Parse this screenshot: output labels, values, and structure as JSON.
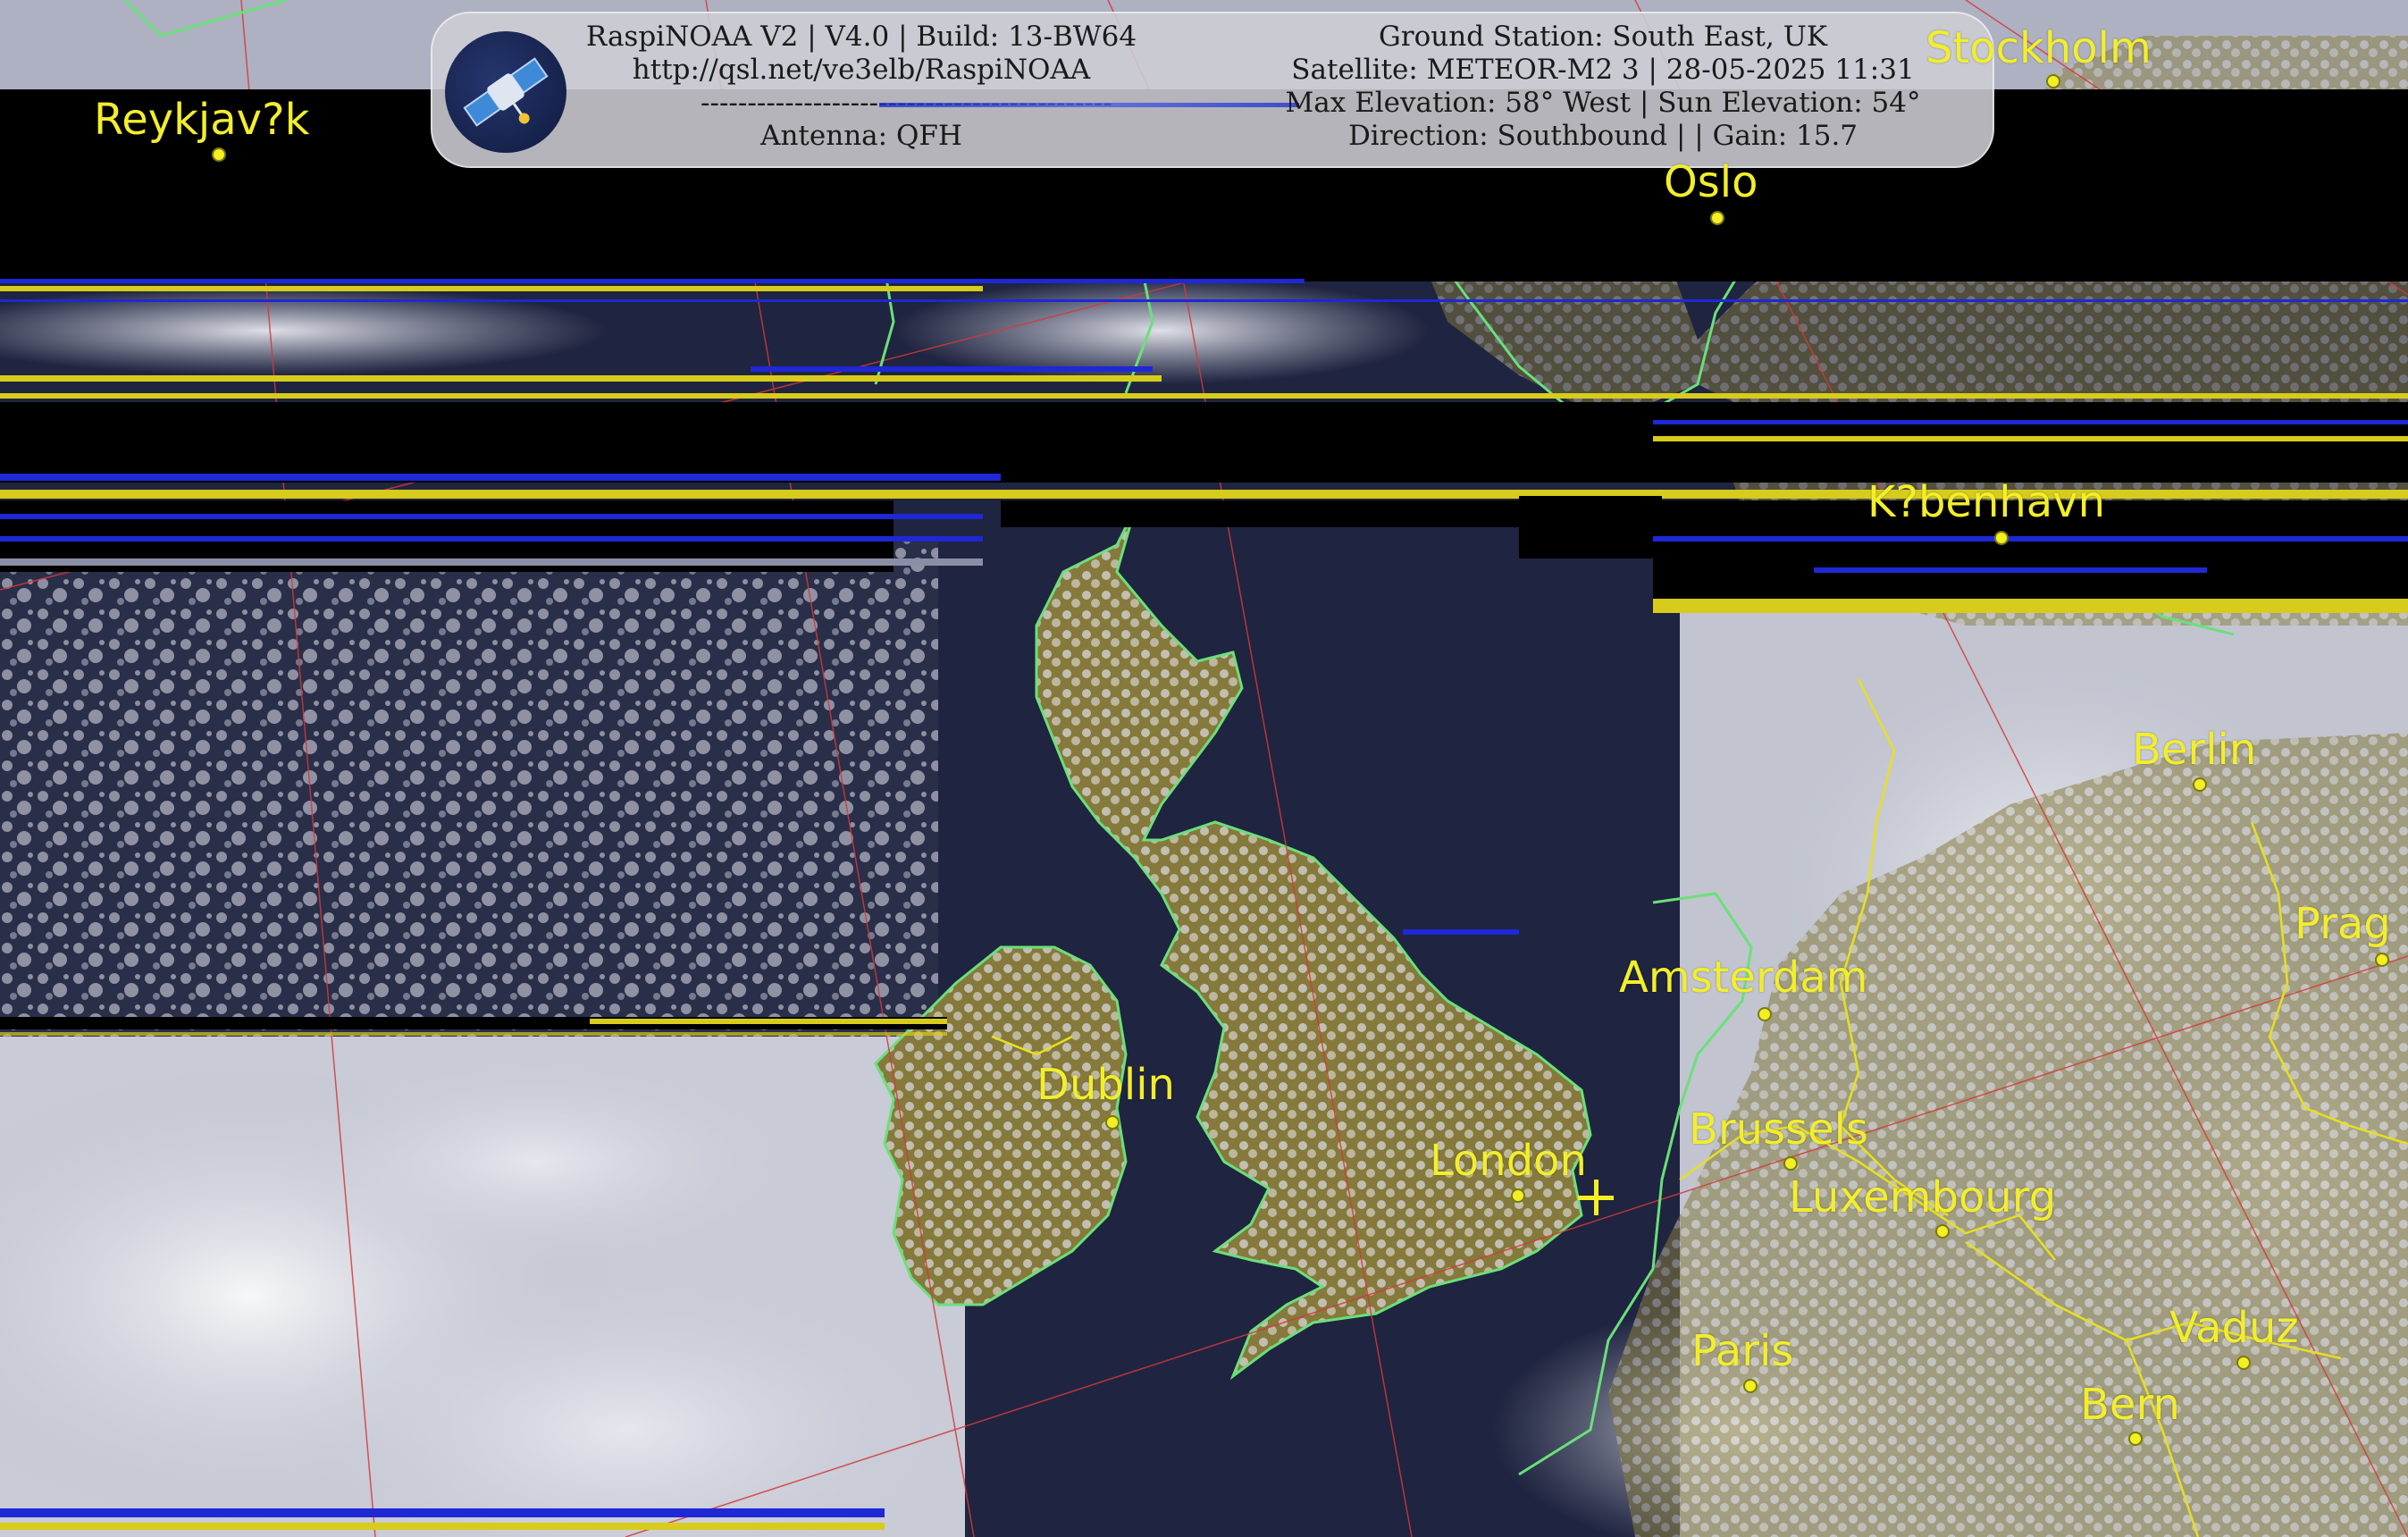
{
  "header": {
    "left": {
      "line1": "RaspiNOAA V2 | V4.0 | Build: 13-BW64",
      "line2": "http://qsl.net/ve3elb/RaspiNOAA",
      "line3": "--------------------------------------------",
      "line4": "Antenna: QFH"
    },
    "right": {
      "line1": "Ground Station: South East, UK",
      "line2": "Satellite: METEOR-M2 3 | 28-05-2025 11:31",
      "line3": "Max Elevation: 58° West | Sun Elevation: 54°",
      "line4": "Direction: Southbound | | Gain: 15.7"
    },
    "logo_icon": "satellite-icon"
  },
  "cities": {
    "reykjavik": "Reykjav?k",
    "stockholm": "Stockholm",
    "oslo": "Oslo",
    "kobenhavn": "K?benhavn",
    "berlin": "Berlin",
    "prag": "Prag",
    "amsterdam": "Amsterdam",
    "dublin": "Dublin",
    "london": "London",
    "brussels": "Brussels",
    "luxembourg": "Luxembourg",
    "paris": "Paris",
    "vaduz": "Vaduz",
    "bern": "Bern"
  },
  "colors": {
    "label": "#f2ee2c",
    "coastline": "#6be07a",
    "border": "#e6e020",
    "grid": "#d23a3a",
    "sea": "#1f2440",
    "cloud": "#d8d9e2",
    "land": "#8a7e3e",
    "noise_black": "#000000",
    "noise_blue": "#1e28d4",
    "noise_yellow": "#d7cc1c"
  }
}
